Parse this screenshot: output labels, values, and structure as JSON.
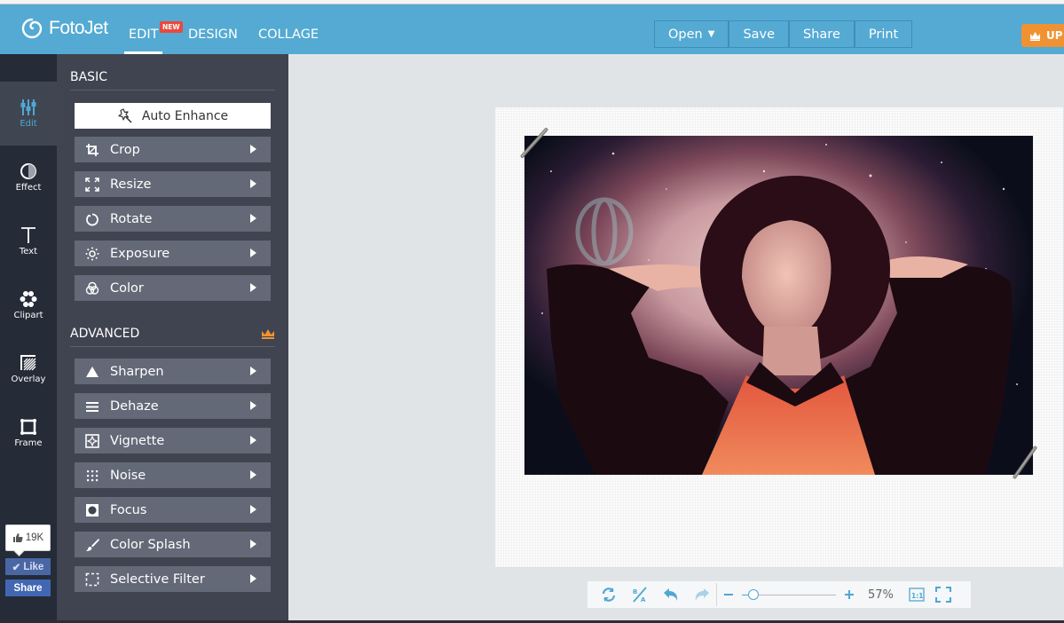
{
  "app": {
    "brand": "FotoJet",
    "nav": [
      {
        "label": "EDIT",
        "active": true,
        "badge": "NEW"
      },
      {
        "label": "DESIGN",
        "active": false
      },
      {
        "label": "COLLAGE",
        "active": false
      }
    ],
    "toolbar": {
      "open": "Open",
      "save": "Save",
      "share": "Share",
      "print": "Print"
    },
    "upgrade_label": "UP",
    "accent_color": "#54aad3",
    "upgrade_color": "#f09232"
  },
  "rail": {
    "items": [
      {
        "label": "Edit",
        "icon": "sliders-icon",
        "active": true
      },
      {
        "label": "Effect",
        "icon": "half-circle-icon"
      },
      {
        "label": "Text",
        "icon": "text-t-icon"
      },
      {
        "label": "Clipart",
        "icon": "flower-icon"
      },
      {
        "label": "Overlay",
        "icon": "hatched-square-icon"
      },
      {
        "label": "Frame",
        "icon": "frame-icon"
      }
    ]
  },
  "panel": {
    "basic_title": "BASIC",
    "auto_enhance": "Auto Enhance",
    "basic_tools": [
      {
        "label": "Crop",
        "icon": "crop-icon"
      },
      {
        "label": "Resize",
        "icon": "resize-icon"
      },
      {
        "label": "Rotate",
        "icon": "rotate-icon"
      },
      {
        "label": "Exposure",
        "icon": "sun-icon"
      },
      {
        "label": "Color",
        "icon": "color-circles-icon"
      }
    ],
    "advanced_title": "ADVANCED",
    "advanced_tools": [
      {
        "label": "Sharpen",
        "icon": "triangle-icon"
      },
      {
        "label": "Dehaze",
        "icon": "lines-icon"
      },
      {
        "label": "Vignette",
        "icon": "vignette-icon"
      },
      {
        "label": "Noise",
        "icon": "dots-grid-icon"
      },
      {
        "label": "Focus",
        "icon": "focus-icon"
      },
      {
        "label": "Color Splash",
        "icon": "brush-icon"
      },
      {
        "label": "Selective Filter",
        "icon": "dashed-square-icon"
      }
    ]
  },
  "social": {
    "like_count": "19K",
    "like_label": "Like",
    "share_label": "Share"
  },
  "canvas": {
    "image_description": "Woman in a wide-brimmed hat with arms behind head against a starry galaxy background, with a faded hot-air balloon clipart"
  },
  "bottom_bar": {
    "zoom_percent": "57%",
    "zoom_value": 0.57,
    "actual_size_label": "1:1"
  }
}
